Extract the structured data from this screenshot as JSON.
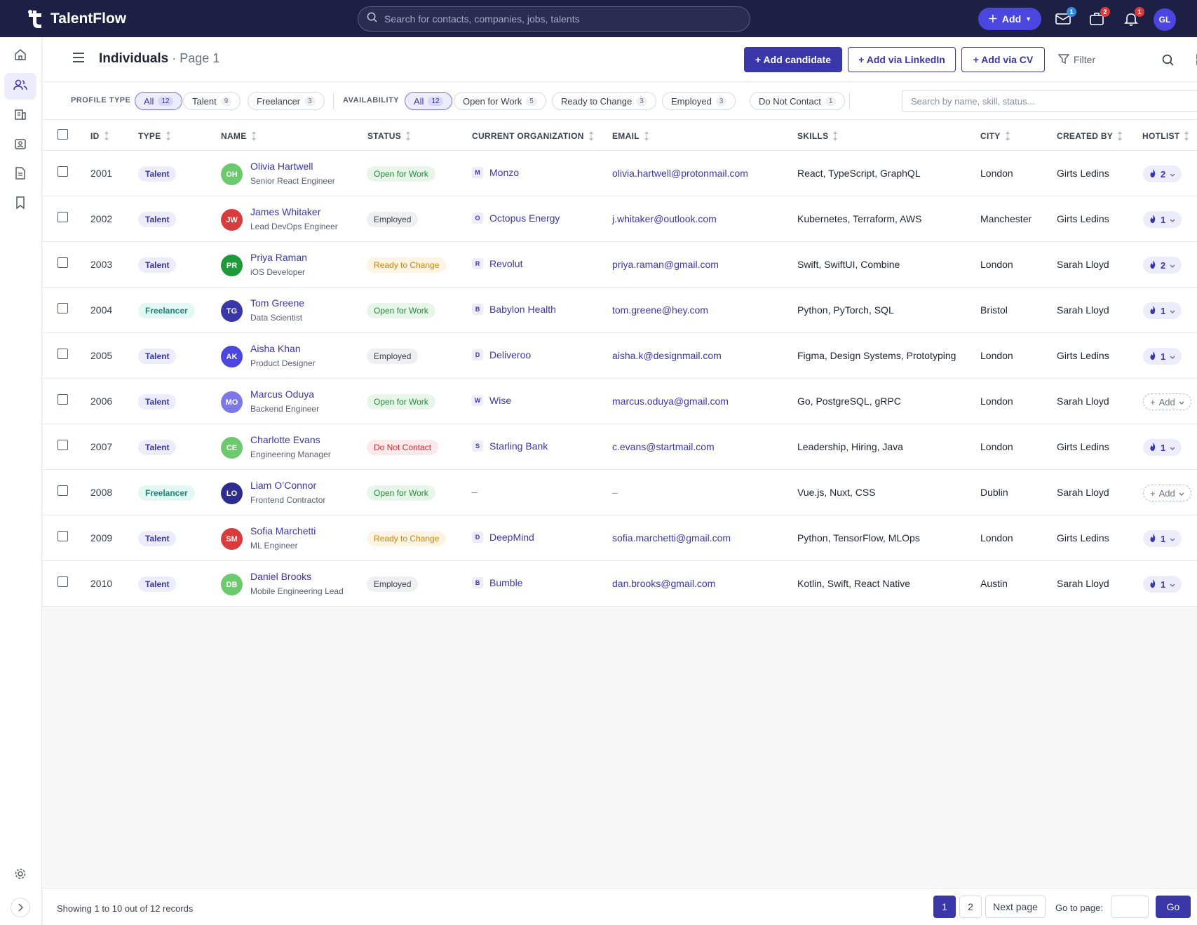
{
  "app": {
    "name": "TalentFlow"
  },
  "topbar": {
    "search_placeholder": "Search for contacts, companies, jobs, talents",
    "add_label": "Add",
    "mail_badge": "1",
    "jobs_badge": "2",
    "notif_badge": "1",
    "user_initials": "GL"
  },
  "header": {
    "title": "Individuals",
    "subtitle": " · Page 1",
    "add_candidate": "+ Add candidate",
    "add_linkedin": "+ Add via LinkedIn",
    "add_cv": "+ Add via CV",
    "filter": "Filter"
  },
  "filters": {
    "profile_label": "PROFILE TYPE",
    "profile": [
      {
        "label": "All",
        "count": "12"
      },
      {
        "label": "Talent",
        "count": "9"
      },
      {
        "label": "Freelancer",
        "count": "3"
      }
    ],
    "availability_label": "AVAILABILITY",
    "availability": [
      {
        "label": "All",
        "count": "12"
      },
      {
        "label": "Open for Work",
        "count": "5"
      },
      {
        "label": "Ready to Change",
        "count": "3"
      },
      {
        "label": "Employed",
        "count": "3"
      },
      {
        "label": "Do Not Contact",
        "count": "1"
      }
    ],
    "search_placeholder": "Search by name, skill, status..."
  },
  "columns": {
    "id": "ID",
    "type": "TYPE",
    "name": "NAME",
    "status": "STATUS",
    "org": "CURRENT ORGANIZATION",
    "email": "EMAIL",
    "skills": "SKILLS",
    "city": "CITY",
    "created_by": "CREATED BY",
    "hotlist": "HOTLIST"
  },
  "rows": [
    {
      "id": "2001",
      "type": "Talent",
      "initials": "OH",
      "avatar_color": "#6cc96e",
      "name": "Olivia Hartwell",
      "role": "Senior React Engineer",
      "status": "Open for Work",
      "org_initial": "M",
      "org": "Monzo",
      "email": "olivia.hartwell@protonmail.com",
      "skills": "React, TypeScript, GraphQL",
      "city": "London",
      "created_by": "Girts Ledins",
      "hotlist": "2"
    },
    {
      "id": "2002",
      "type": "Talent",
      "initials": "JW",
      "avatar_color": "#d93c3c",
      "name": "James Whitaker",
      "role": "Lead DevOps Engineer",
      "status": "Employed",
      "org_initial": "O",
      "org": "Octopus Energy",
      "email": "j.whitaker@outlook.com",
      "skills": "Kubernetes, Terraform, AWS",
      "city": "Manchester",
      "created_by": "Girts Ledins",
      "hotlist": "1"
    },
    {
      "id": "2003",
      "type": "Talent",
      "initials": "PR",
      "avatar_color": "#1e9a3a",
      "name": "Priya Raman",
      "role": "iOS Developer",
      "status": "Ready to Change",
      "org_initial": "R",
      "org": "Revolut",
      "email": "priya.raman@gmail.com",
      "skills": "Swift, SwiftUI, Combine",
      "city": "London",
      "created_by": "Sarah Lloyd",
      "hotlist": "2"
    },
    {
      "id": "2004",
      "type": "Freelancer",
      "initials": "TG",
      "avatar_color": "#3a37a8",
      "name": "Tom Greene",
      "role": "Data Scientist",
      "status": "Open for Work",
      "org_initial": "B",
      "org": "Babylon Health",
      "email": "tom.greene@hey.com",
      "skills": "Python, PyTorch, SQL",
      "city": "Bristol",
      "created_by": "Sarah Lloyd",
      "hotlist": "1"
    },
    {
      "id": "2005",
      "type": "Talent",
      "initials": "AK",
      "avatar_color": "#4c46e0",
      "name": "Aisha Khan",
      "role": "Product Designer",
      "status": "Employed",
      "org_initial": "D",
      "org": "Deliveroo",
      "email": "aisha.k@designmail.com",
      "skills": "Figma, Design Systems, Prototyping",
      "city": "London",
      "created_by": "Girts Ledins",
      "hotlist": "1"
    },
    {
      "id": "2006",
      "type": "Talent",
      "initials": "MO",
      "avatar_color": "#7c79e6",
      "name": "Marcus Oduya",
      "role": "Backend Engineer",
      "status": "Open for Work",
      "org_initial": "W",
      "org": "Wise",
      "email": "marcus.oduya@gmail.com",
      "skills": "Go, PostgreSQL, gRPC",
      "city": "London",
      "created_by": "Sarah Lloyd",
      "hotlist": ""
    },
    {
      "id": "2007",
      "type": "Talent",
      "initials": "CE",
      "avatar_color": "#6cc96e",
      "name": "Charlotte Evans",
      "role": "Engineering Manager",
      "status": "Do Not Contact",
      "org_initial": "S",
      "org": "Starling Bank",
      "email": "c.evans@startmail.com",
      "skills": "Leadership, Hiring, Java",
      "city": "London",
      "created_by": "Girts Ledins",
      "hotlist": "1"
    },
    {
      "id": "2008",
      "type": "Freelancer",
      "initials": "LO",
      "avatar_color": "#2f2c8f",
      "name": "Liam O’Connor",
      "role": "Frontend Contractor",
      "status": "Open for Work",
      "org_initial": "",
      "org": "–",
      "email": "–",
      "skills": "Vue.js, Nuxt, CSS",
      "city": "Dublin",
      "created_by": "Sarah Lloyd",
      "hotlist": ""
    },
    {
      "id": "2009",
      "type": "Talent",
      "initials": "SM",
      "avatar_color": "#d93c3c",
      "name": "Sofia Marchetti",
      "role": "ML Engineer",
      "status": "Ready to Change",
      "org_initial": "D",
      "org": "DeepMind",
      "email": "sofia.marchetti@gmail.com",
      "skills": "Python, TensorFlow, MLOps",
      "city": "London",
      "created_by": "Girts Ledins",
      "hotlist": "1"
    },
    {
      "id": "2010",
      "type": "Talent",
      "initials": "DB",
      "avatar_color": "#6cc96e",
      "name": "Daniel Brooks",
      "role": "Mobile Engineering Lead",
      "status": "Employed",
      "org_initial": "B",
      "org": "Bumble",
      "email": "dan.brooks@gmail.com",
      "skills": "Kotlin, Swift, React Native",
      "city": "Austin",
      "created_by": "Sarah Lloyd",
      "hotlist": "1"
    }
  ],
  "hotlist_add_label": "Add",
  "footer": {
    "showing": "Showing 1 to 10 out of 12 records",
    "pages": [
      "1",
      "2"
    ],
    "next": "Next page",
    "goto": "Go to page:",
    "go": "Go"
  }
}
